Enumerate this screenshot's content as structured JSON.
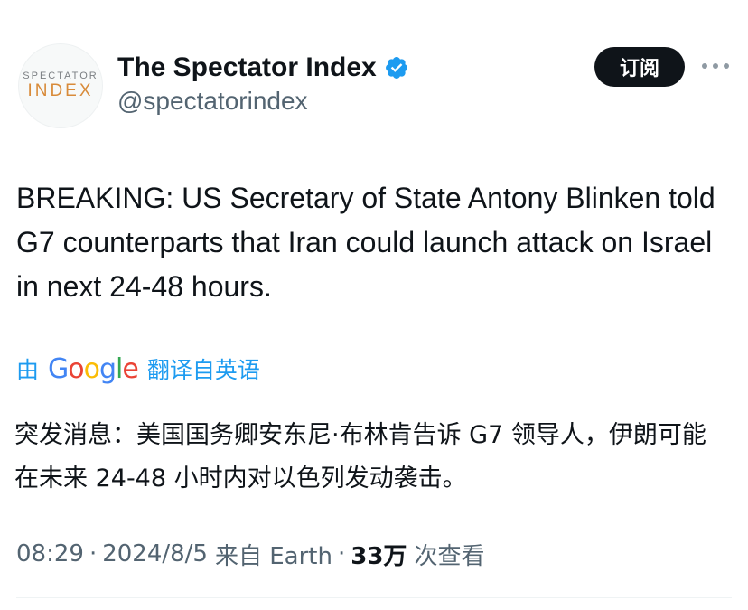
{
  "author": {
    "avatar_text_top": "SPECTATOR",
    "avatar_text_bottom": "INDEX",
    "display_name": "The Spectator Index",
    "handle": "@spectatorindex",
    "verified": true
  },
  "actions": {
    "subscribe_label": "订阅",
    "more_icon": "more-horizontal-icon"
  },
  "tweet": {
    "text": "BREAKING: US Secretary of State Antony Blinken told G7 counterparts that Iran could launch attack on Israel in next 24-48 hours.",
    "translate_prefix": "由",
    "translate_brand": "Google",
    "translate_suffix": "翻译自英语",
    "translated_text": "突发消息：美国国务卿安东尼·布林肯告诉 G7 领导人，伊朗可能在未来 24-48 小时内对以色列发动袭击。"
  },
  "meta": {
    "time": "08:29",
    "date": "2024/8/5",
    "source": "来自 Earth",
    "separator": "·",
    "views_count": "33万",
    "views_label": "次查看"
  },
  "colors": {
    "accent": "#1d9bf0",
    "text_primary": "#0f1419",
    "text_secondary": "#536471",
    "button_bg": "#0f1419"
  }
}
